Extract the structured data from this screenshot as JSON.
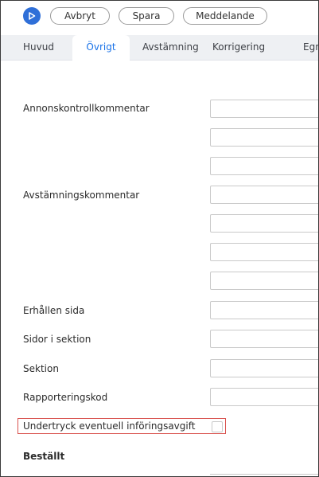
{
  "toolbar": {
    "play_icon": "play-icon",
    "cancel_label": "Avbryt",
    "save_label": "Spara",
    "message_label": "Meddelande",
    "accent_color": "#2f6fd8"
  },
  "tabs": [
    {
      "label": "Huvud",
      "active": false
    },
    {
      "label": "Övrigt",
      "active": true
    },
    {
      "label": "Avstämning",
      "active": false
    },
    {
      "label": "Korrigering",
      "active": false
    },
    {
      "label": "Egn",
      "active": false
    }
  ],
  "form": {
    "annonskontroll_label": "Annonskontrollkommentar",
    "avstamning_label": "Avstämningskommentar",
    "erhallen_sida_label": "Erhållen sida",
    "sidor_i_sektion_label": "Sidor i sektion",
    "sektion_label": "Sektion",
    "rapporteringskod_label": "Rapporteringskod",
    "undertryck_label": "Undertryck eventuell införingsavgift",
    "undertryck_checked": false,
    "bestallt_heading": "Beställt"
  }
}
